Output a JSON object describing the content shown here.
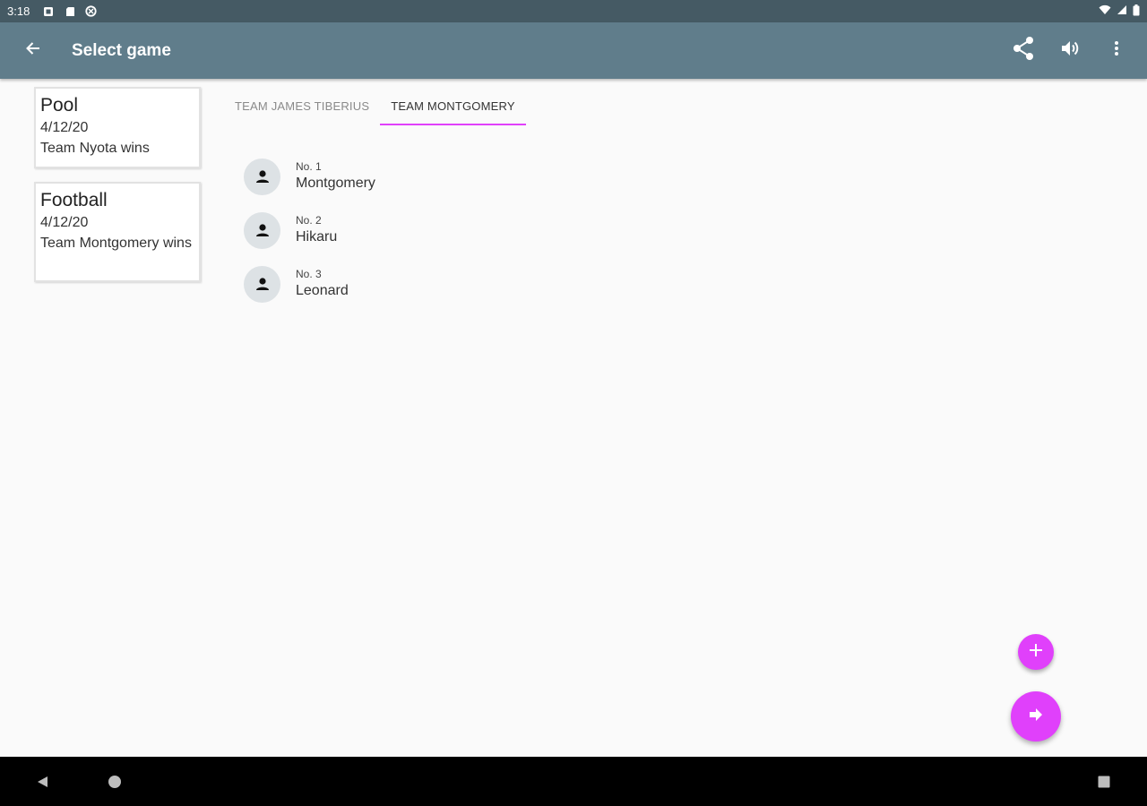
{
  "status_bar": {
    "time": "3:18",
    "left_icons": [
      "sim-card-icon",
      "sd-card-icon",
      "data-saver-icon"
    ],
    "right_icons": [
      "wifi-icon",
      "cellular-signal-icon",
      "battery-icon"
    ]
  },
  "app_bar": {
    "title": "Select game",
    "back_icon": "arrow-back-icon",
    "actions": [
      "share-icon",
      "volume-icon",
      "more-vert-icon"
    ]
  },
  "games": [
    {
      "name": "Pool",
      "date": "4/12/20",
      "result": "Team Nyota wins"
    },
    {
      "name": "Football",
      "date": "4/12/20",
      "result": "Team Montgomery wins"
    }
  ],
  "tabs": [
    {
      "label": "TEAM JAMES TIBERIUS",
      "active": false
    },
    {
      "label": "TEAM MONTGOMERY",
      "active": true
    }
  ],
  "players": [
    {
      "number": "No. 1",
      "name": "Montgomery"
    },
    {
      "number": "No. 2",
      "name": "Hikaru"
    },
    {
      "number": "No. 3",
      "name": "Leonard"
    }
  ],
  "fabs": {
    "small_icon": "add-icon",
    "large_icon": "arrow-forward-icon"
  },
  "nav_bar": [
    "back-triangle-icon",
    "home-circle-icon",
    "recents-square-icon"
  ],
  "colors": {
    "status_bar": "#455a64",
    "app_bar": "#607d8b",
    "accent": "#e040fb",
    "background": "#fafafa"
  }
}
